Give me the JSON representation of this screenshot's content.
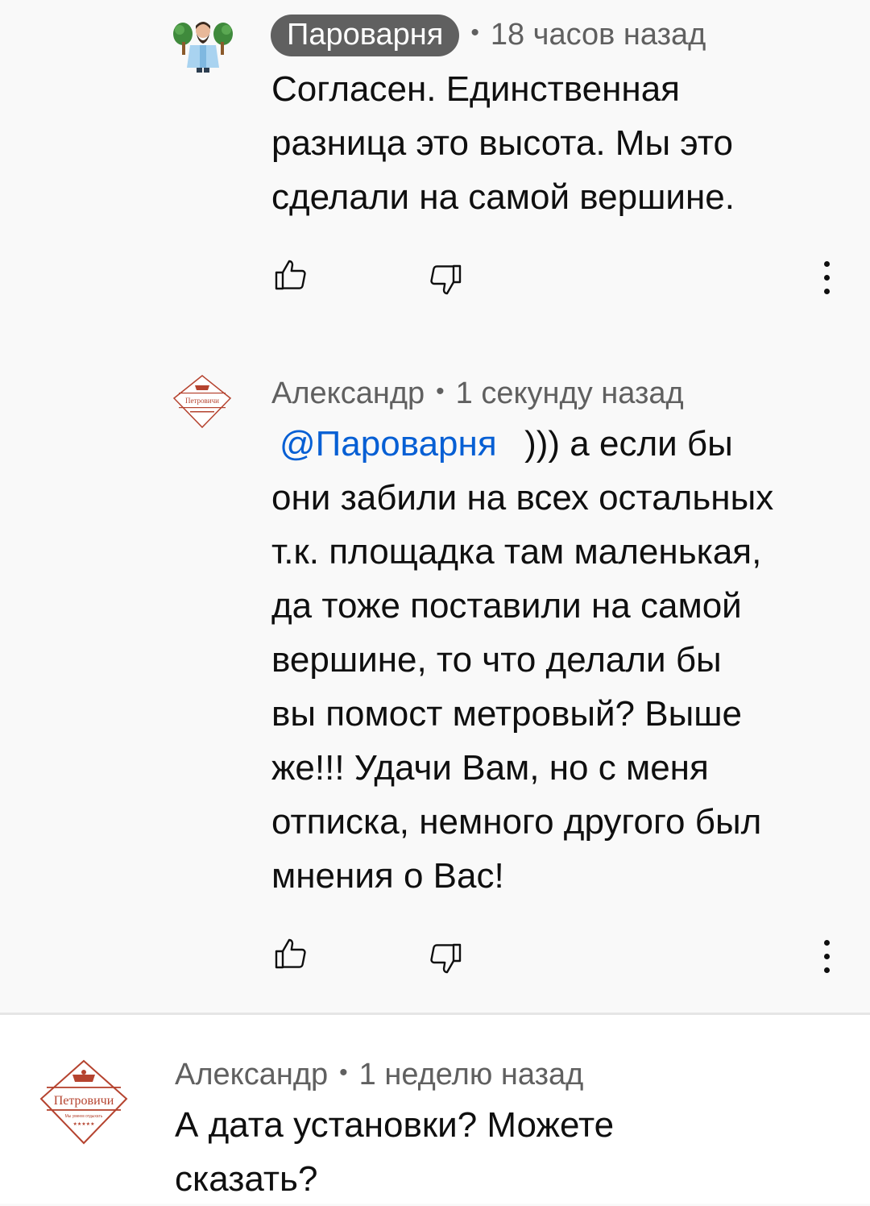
{
  "comments": [
    {
      "author": "Пароварня",
      "author_is_creator_chip": true,
      "separator": "•",
      "time": "18 часов назад",
      "text_lines": [
        "Согласен.  Единственная",
        "разница это высота. Мы это",
        "сделали на самой вершине."
      ],
      "avatar_icon": "bearded-man-with-brooms-avatar"
    },
    {
      "author": "Александр",
      "separator": "•",
      "time": "1 секунду назад",
      "mention": "@Пароварня",
      "text_first_line_rest": "))) а если бы",
      "text_lines": [
        "они забили на всех остальных",
        "т.к. площадка там маленькая,",
        "да тоже поставили на самой",
        "вершине, то что делали бы",
        "вы помост метровый? Выше",
        "же!!! Удачи Вам, но с меня",
        "отписка, немного другого был",
        "мнения о Вас!"
      ],
      "avatar_text": "Петровичи",
      "avatar_icon": "petrovichi-logo-avatar"
    },
    {
      "author": "Александр",
      "separator": "•",
      "time": "1 неделю назад",
      "text_lines": [
        "А дата установки?  Можете",
        "сказать?"
      ],
      "avatar_text": "Петровичи",
      "avatar_subtext": "Мы умеем отдыхать",
      "avatar_icon": "petrovichi-logo-avatar"
    }
  ],
  "icons": {
    "like": "thumbs-up-icon",
    "dislike": "thumbs-down-icon",
    "more": "more-vertical-icon"
  },
  "colors": {
    "background": "#f9f9f9",
    "text": "#0f0f0f",
    "secondary_text": "#606060",
    "mention": "#065fd4",
    "logo_red": "#b5432f"
  }
}
